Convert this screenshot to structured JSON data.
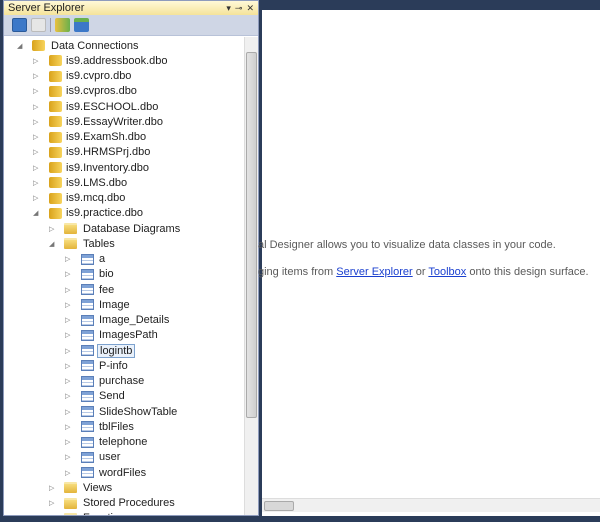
{
  "panel": {
    "title": "Server Explorer",
    "pin": "⊸",
    "close": "✕",
    "dropdown": "▾"
  },
  "toolbar": [
    "refresh",
    "stop",
    "connect-to-database",
    "connect-to-server"
  ],
  "tree": {
    "root": "Data Connections",
    "connections": [
      "is9.addressbook.dbo",
      "is9.cvpro.dbo",
      "is9.cvpros.dbo",
      "is9.ESCHOOL.dbo",
      "is9.EssayWriter.dbo",
      "is9.ExamSh.dbo",
      "is9.HRMSPrj.dbo",
      "is9.Inventory.dbo",
      "is9.LMS.dbo",
      "is9.mcq.dbo",
      "is9.practice.dbo"
    ],
    "folders": {
      "diagrams": "Database Diagrams",
      "tables": "Tables",
      "views": "Views",
      "procs": "Stored Procedures",
      "functions": "Functions"
    },
    "tables": [
      "a",
      "bio",
      "fee",
      "Image",
      "Image_Details",
      "ImagesPath",
      "logintb",
      "P-info",
      "purchase",
      "Send",
      "SlideShowTable",
      "tblFiles",
      "telephone",
      "user",
      "wordFiles"
    ],
    "selected": "logintb"
  },
  "designer": {
    "line1": "al Designer allows you to visualize data classes in your code.",
    "line2_pre": "ging items from ",
    "link1": "Server Explorer",
    "line2_mid": " or ",
    "link2": "Toolbox",
    "line2_post": " onto this design surface."
  }
}
